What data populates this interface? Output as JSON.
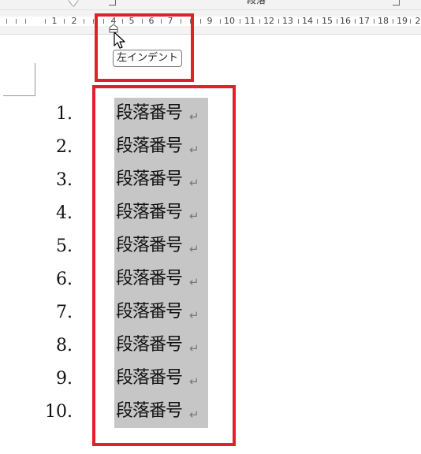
{
  "ribbon": {
    "group_label": "段落"
  },
  "ruler": {
    "ticks": [
      "1",
      "2",
      "4",
      "5",
      "6",
      "7",
      "9",
      "10",
      "11",
      "12",
      "13",
      "14",
      "15",
      "16",
      "17",
      "18",
      "19",
      "2"
    ]
  },
  "tooltip": {
    "text": "左インデント"
  },
  "list": {
    "items": [
      {
        "num": "1.",
        "text": "段落番号",
        "mark": "↵"
      },
      {
        "num": "2.",
        "text": "段落番号",
        "mark": "↵"
      },
      {
        "num": "3.",
        "text": "段落番号",
        "mark": "↵"
      },
      {
        "num": "4.",
        "text": "段落番号",
        "mark": "↵"
      },
      {
        "num": "5.",
        "text": "段落番号",
        "mark": "↵"
      },
      {
        "num": "6.",
        "text": "段落番号",
        "mark": "↵"
      },
      {
        "num": "7.",
        "text": "段落番号",
        "mark": "↵"
      },
      {
        "num": "8.",
        "text": "段落番号",
        "mark": "↵"
      },
      {
        "num": "9.",
        "text": "段落番号",
        "mark": "↵"
      },
      {
        "num": "10.",
        "text": "段落番号",
        "mark": "↵"
      }
    ]
  },
  "colors": {
    "highlight_box": "#e0202a",
    "selection": "#c6c6c6",
    "paragraph_mark": "#777777"
  },
  "icons": {
    "left_indent_marker": "house-indent-icon",
    "cursor": "arrow-cursor-icon"
  }
}
